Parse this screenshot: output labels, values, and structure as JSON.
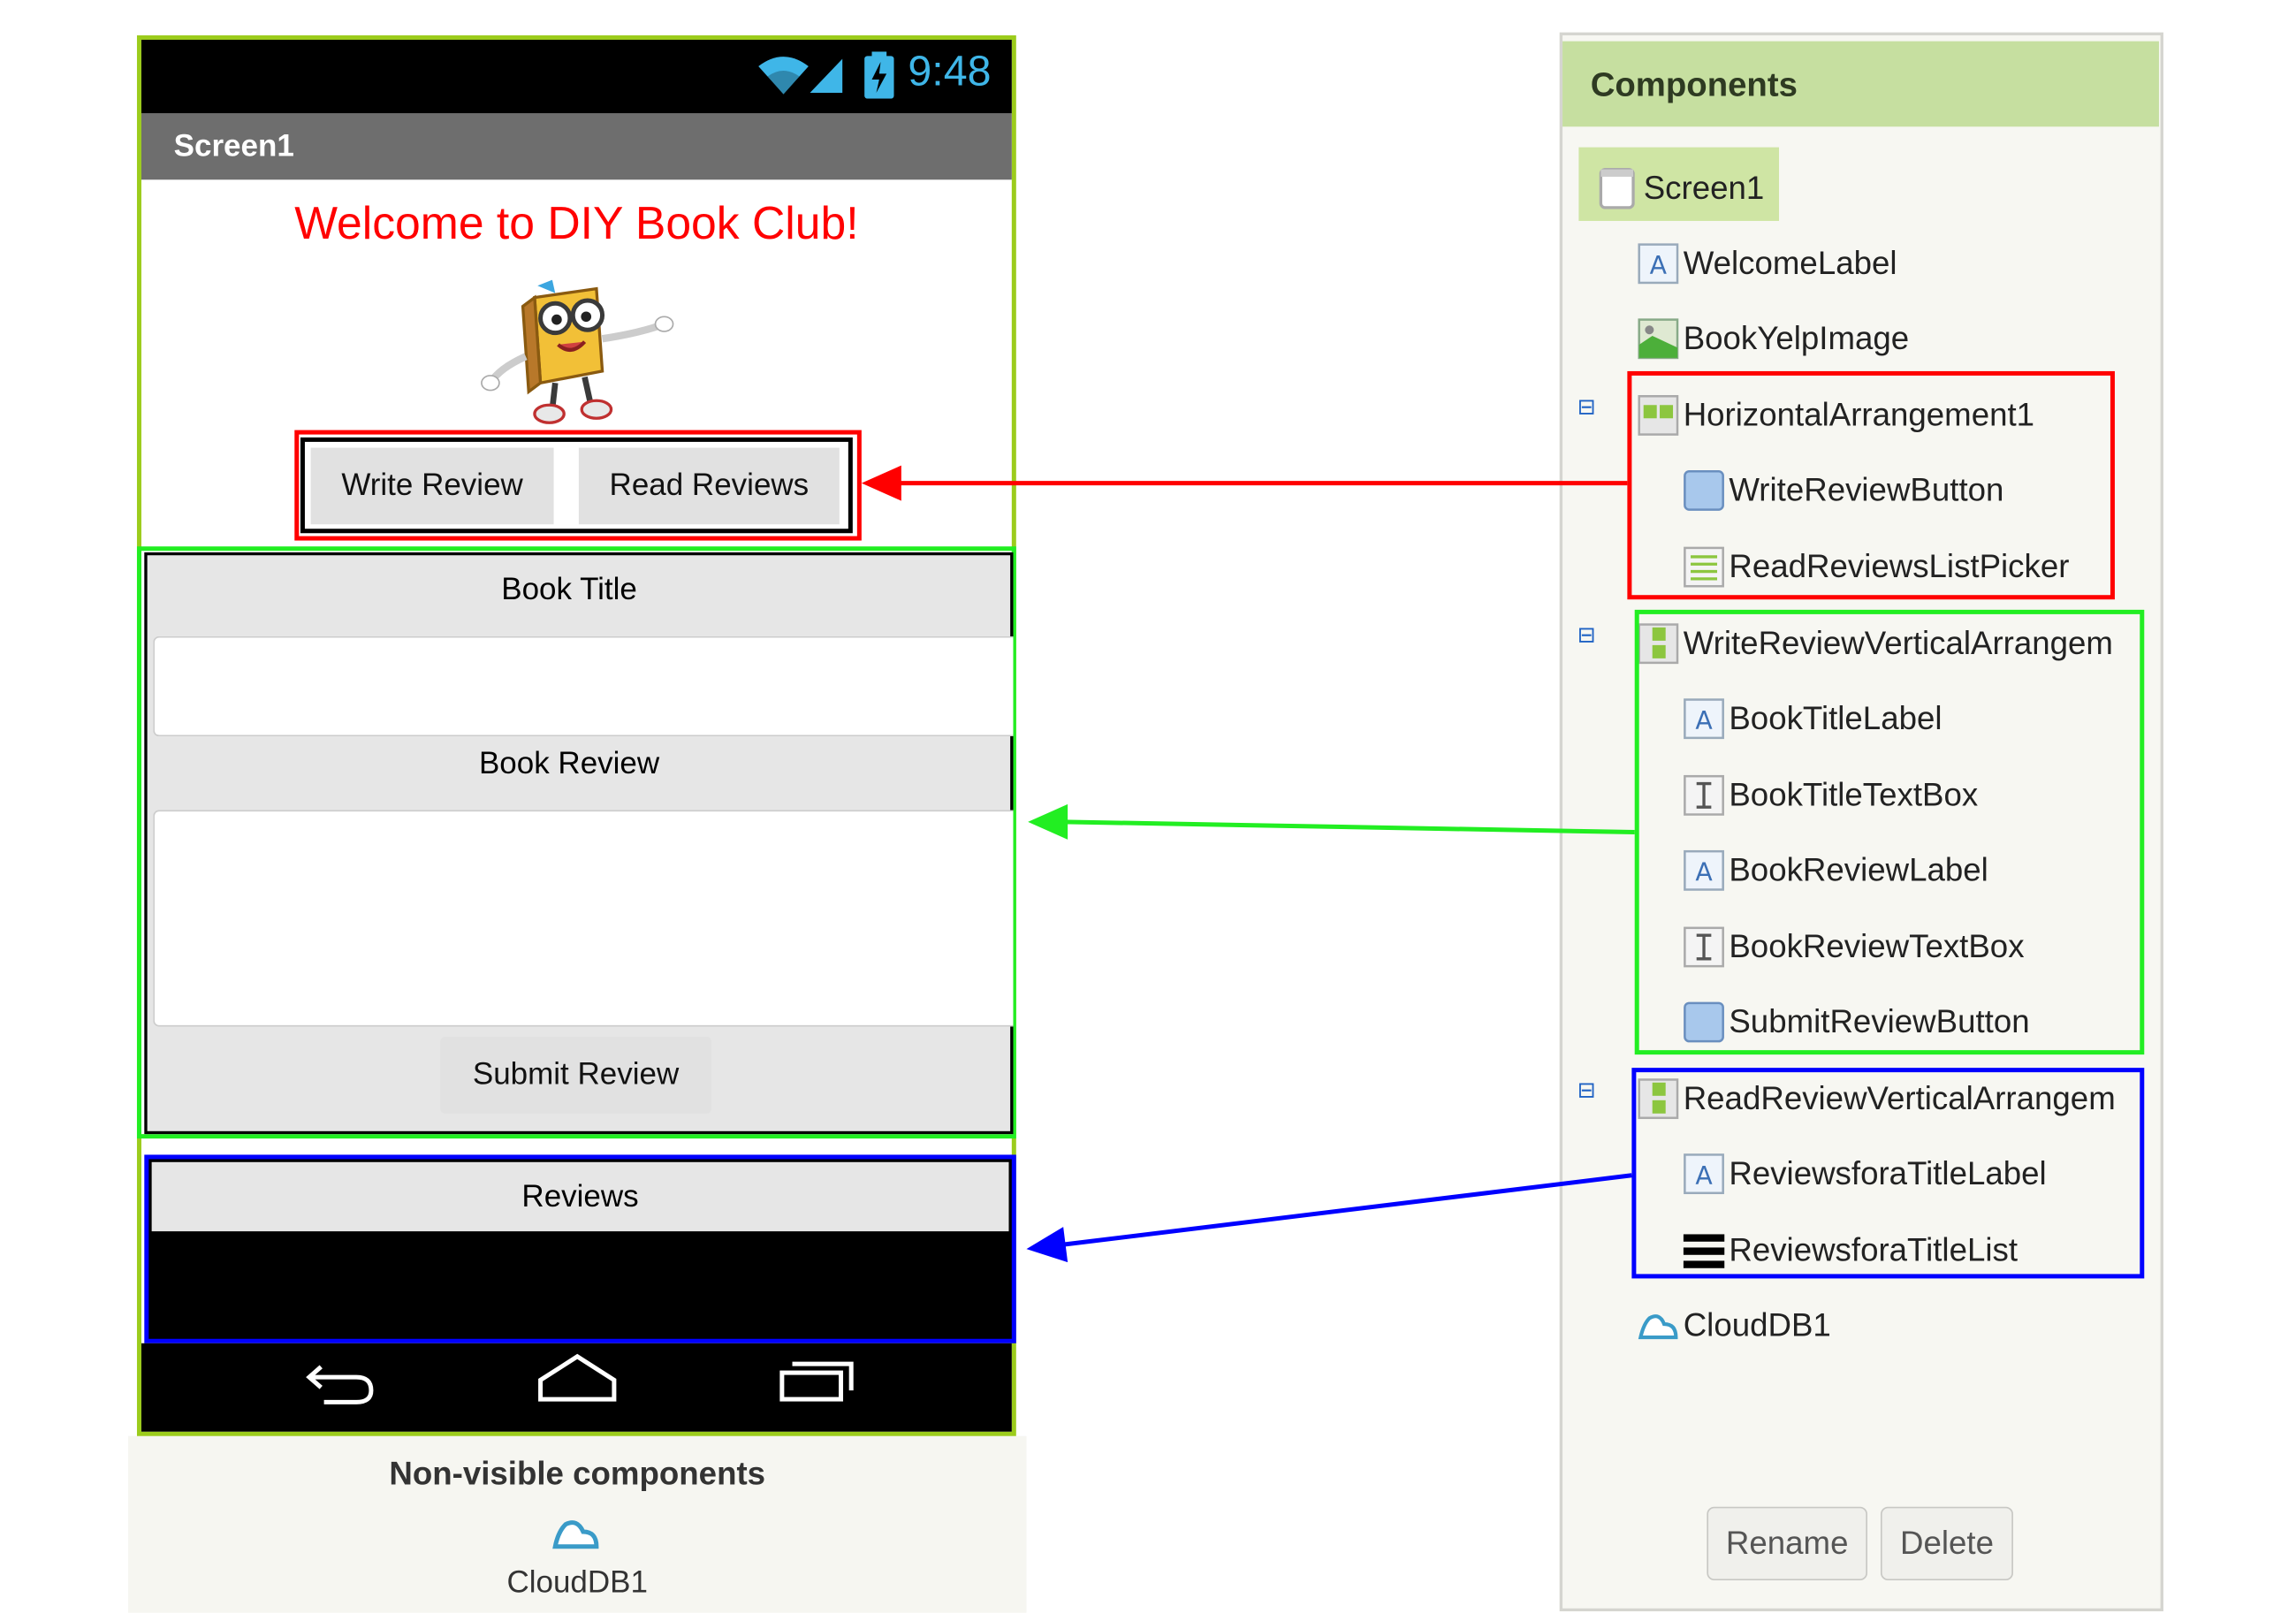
{
  "phone": {
    "status_time": "9:48",
    "screen_title": "Screen1",
    "welcome_text": "Welcome to DIY Book Club!",
    "write_review_button": "Write Review",
    "read_reviews_button": "Read Reviews",
    "book_title_label": "Book Title",
    "book_title_value": "",
    "book_review_label": "Book Review",
    "book_review_value": "",
    "submit_button": "Submit Review",
    "reviews_label": "Reviews"
  },
  "non_visible": {
    "title": "Non-visible components",
    "items": [
      "CloudDB1"
    ]
  },
  "components": {
    "header": "Components",
    "tree": [
      {
        "label": "Screen1",
        "icon": "screen-icon"
      },
      {
        "label": "WelcomeLabel",
        "icon": "label-icon"
      },
      {
        "label": "BookYelpImage",
        "icon": "image-icon"
      },
      {
        "label": "HorizontalArrangement1",
        "icon": "horizontal-arrangement-icon"
      },
      {
        "label": "WriteReviewButton",
        "icon": "button-icon"
      },
      {
        "label": "ReadReviewsListPicker",
        "icon": "listpicker-icon"
      },
      {
        "label": "WriteReviewVerticalArrangem",
        "icon": "vertical-arrangement-icon"
      },
      {
        "label": "BookTitleLabel",
        "icon": "label-icon"
      },
      {
        "label": "BookTitleTextBox",
        "icon": "textbox-icon"
      },
      {
        "label": "BookReviewLabel",
        "icon": "label-icon"
      },
      {
        "label": "BookReviewTextBox",
        "icon": "textbox-icon"
      },
      {
        "label": "SubmitReviewButton",
        "icon": "button-icon"
      },
      {
        "label": "ReadReviewVerticalArrangem",
        "icon": "vertical-arrangement-icon"
      },
      {
        "label": "ReviewsforaTitleLabel",
        "icon": "label-icon"
      },
      {
        "label": "ReviewsforaTitleList",
        "icon": "listview-icon"
      },
      {
        "label": "CloudDB1",
        "icon": "cloud-icon"
      }
    ],
    "rename_button": "Rename",
    "delete_button": "Delete"
  },
  "annotation_colors": {
    "red": "#ff0000",
    "green": "#22ee22",
    "blue": "#0000ff",
    "phone_border": "#9ccc1c"
  }
}
